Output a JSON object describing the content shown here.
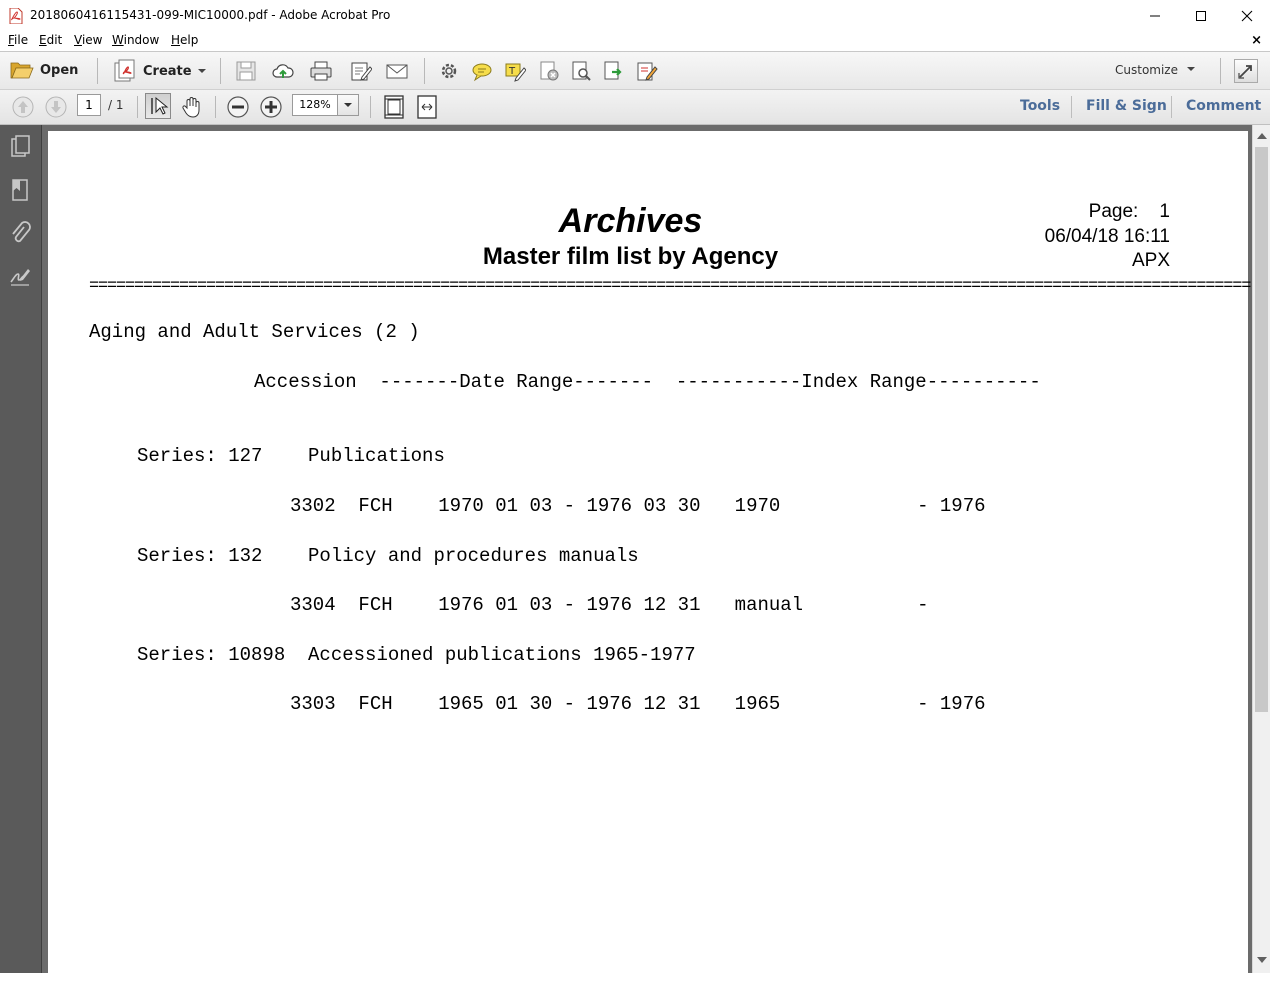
{
  "window": {
    "title": "2018060416115431-099-MIC10000.pdf - Adobe Acrobat Pro",
    "minimize_icon": "minimize-icon",
    "maximize_icon": "maximize-icon",
    "close_icon": "close-icon"
  },
  "menu": {
    "items": [
      {
        "accel": "F",
        "rest": "ile"
      },
      {
        "accel": "E",
        "rest": "dit"
      },
      {
        "accel": "V",
        "rest": "iew"
      },
      {
        "accel": "W",
        "rest": "indow"
      },
      {
        "accel": "H",
        "rest": "elp"
      }
    ],
    "close_glyph": "×"
  },
  "toolbar": {
    "open_label": "Open",
    "create_label": "Create",
    "customize_label": "Customize",
    "icons": [
      "folder-open-icon",
      "create-pdf-icon",
      "save-icon",
      "cloud-upload-icon",
      "print-icon",
      "edit-pdf-icon",
      "email-icon",
      "settings-icon",
      "comment-icon",
      "highlight-icon",
      "delete-page-icon",
      "search-doc-icon",
      "export-icon",
      "sign-icon",
      "expand-icon"
    ]
  },
  "nav": {
    "page_current": "1",
    "page_total": "/ 1",
    "zoom": "128%",
    "tools_label": "Tools",
    "fill_sign_label": "Fill & Sign",
    "comment_label": "Comment"
  },
  "document": {
    "title": "Archives",
    "subtitle": "Master film list by Agency",
    "page_label": "Page:    1",
    "datetime": "06/04/18 16:11",
    "code": "APX",
    "rule": "=================================================================================================================================",
    "agency": "Aging and Adult Services (2 )",
    "columns_header": "Accession  -------Date Range-------  -----------Index Range----------",
    "series": [
      {
        "line": "Series: 127    Publications",
        "row": "3302  FCH    1970 01 03 - 1976 03 30   1970            - 1976"
      },
      {
        "line": "Series: 132    Policy and procedures manuals",
        "row": "3304  FCH    1976 01 03 - 1976 12 31   manual          -"
      },
      {
        "line": "Series: 10898  Accessioned publications 1965-1977",
        "row": "3303  FCH    1965 01 30 - 1976 12 31   1965            - 1976"
      }
    ]
  },
  "side_panel": {
    "icons": [
      "page-thumbnails-icon",
      "bookmarks-icon",
      "attachments-icon",
      "signatures-icon"
    ]
  }
}
